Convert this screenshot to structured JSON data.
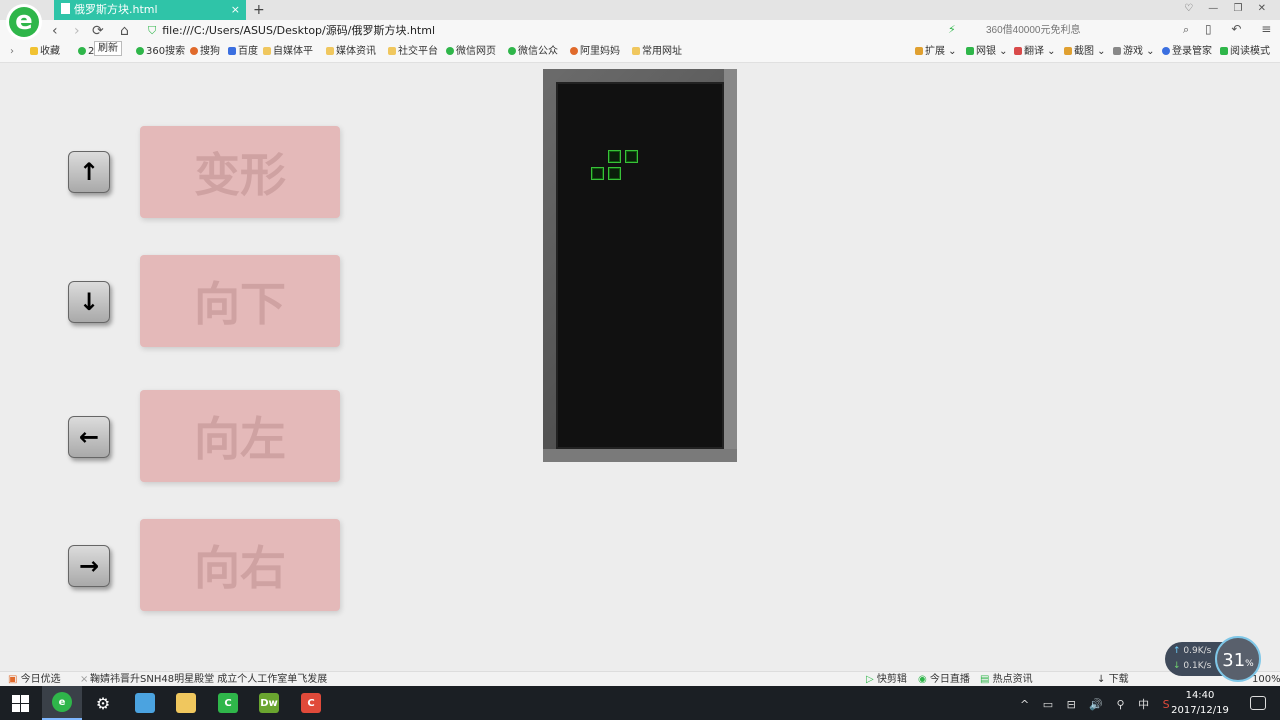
{
  "browser": {
    "tab_title": "俄罗斯方块.html",
    "tab_close": "×",
    "new_tab": "+",
    "window_controls": "♡ — ❐ ✕",
    "url": "file:///C:/Users/ASUS/Desktop/源码/俄罗斯方块.html",
    "search_placeholder": "360借40000元免利息",
    "refresh_tooltip": "刷新",
    "nav": {
      "back": "‹",
      "forward": "›",
      "refresh": "⟳",
      "home": "⌂"
    },
    "right_nav": "▯ ↶ ≡"
  },
  "bookmarks": {
    "left": [
      "收藏",
      "2",
      "360搜索",
      "搜狗",
      "百度",
      "自媒体平",
      "媒体资讯",
      "社交平台",
      "微信网页",
      "微信公众",
      "阿里妈妈",
      "常用网址"
    ],
    "right": [
      "扩展",
      "网银",
      "翻译",
      "截图",
      "游戏",
      "登录管家",
      "阅读模式"
    ]
  },
  "game": {
    "controls": [
      {
        "key": "↑",
        "label": "变形"
      },
      {
        "key": "↓",
        "label": "向下"
      },
      {
        "key": "←",
        "label": "向左"
      },
      {
        "key": "→",
        "label": "向右"
      }
    ],
    "piece": {
      "type": "S",
      "cells": [
        [
          4,
          4
        ],
        [
          5,
          4
        ],
        [
          3,
          5
        ],
        [
          4,
          5
        ]
      ]
    }
  },
  "status": {
    "left": "今日优选",
    "news": "鞠婧祎晋升SNH48明星殿堂 成立个人工作室单飞发展",
    "right": [
      "快剪辑",
      "今日直播",
      "热点资讯",
      "下载",
      "100%"
    ]
  },
  "speed": {
    "up": "0.9K/s",
    "down": "0.1K/s",
    "percent": "31",
    "percent_unit": "%"
  },
  "taskbar": {
    "time": "14:40",
    "date": "2017/12/19",
    "ime": "中"
  },
  "colors": {
    "tab": "#2fc4a8",
    "piece": "#39c139",
    "board": "#111111",
    "action_bg": "#e4b9b9"
  }
}
